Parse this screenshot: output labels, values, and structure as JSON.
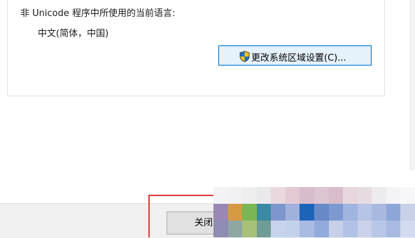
{
  "language_section": {
    "heading": "非 Unicode 程序中所使用的当前语言:",
    "current_language": "中文(简体，中国)",
    "change_button_label": "更改系统区域设置(C)..."
  },
  "footer": {
    "close_button_label": "关闭"
  },
  "mosaic_colors": [
    "#ffffff",
    "#ffffff",
    "#ffffff",
    "#ffffff",
    "#ffffff",
    "#ffffff",
    "#ffffff",
    "#ffffff",
    "#ffffff",
    "#ffffff",
    "#ffffff",
    "#ffffff",
    "#ffffff",
    "#ffffff",
    "#f3f3f5",
    "#f1f1f3",
    "#eeeeee",
    "#e9e9ec",
    "#ead8df",
    "#e4c9d4",
    "#d9bccb",
    "#dcc4d0",
    "#d8bccb",
    "#e8d6de",
    "#e6dbe1",
    "#ececee",
    "#f4f4f6",
    "#f7f7f9",
    "#9a87b3",
    "#d69a45",
    "#7ab655",
    "#3a8aa3",
    "#7d96cc",
    "#a0b2dc",
    "#1d63b8",
    "#6889c8",
    "#7c99d0",
    "#9fb5df",
    "#b6c5e6",
    "#a8b8df",
    "#8ea7d9",
    "#c8d1e8",
    "#8e8cb2",
    "#8fa6a3",
    "#a7c178",
    "#6f9c94",
    "#c7d3ec",
    "#c4d1ea",
    "#a9bbe3",
    "#93aadc",
    "#c7d0e9",
    "#b2c2e6",
    "#c9d2ea",
    "#b8c6e8",
    "#a8bae2",
    "#d2dbef"
  ]
}
